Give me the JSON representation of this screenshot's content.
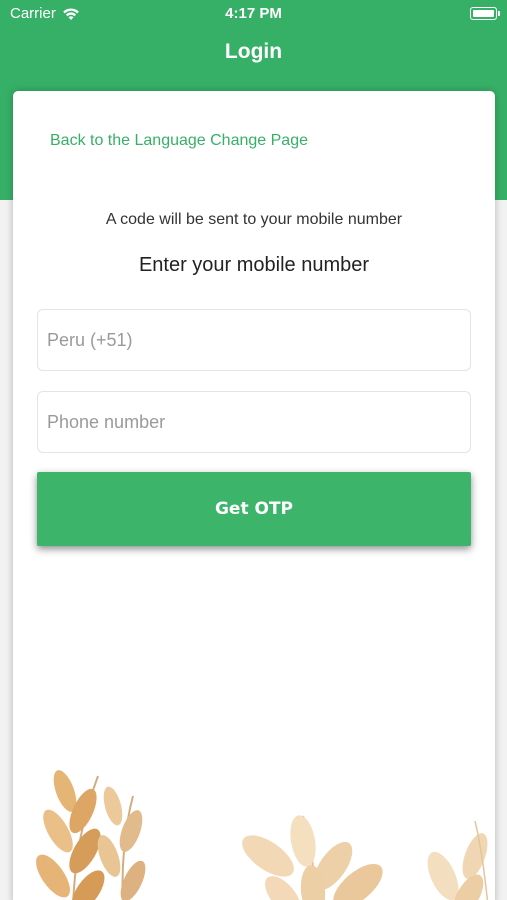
{
  "status_bar": {
    "carrier": "Carrier",
    "time": "4:17 PM"
  },
  "nav": {
    "title": "Login"
  },
  "card": {
    "back_link": "Back to the Language Change Page",
    "info_text": "A code will be sent to your mobile number",
    "heading": "Enter your mobile number",
    "country_field": "Peru (+51)",
    "phone_placeholder": "Phone number",
    "otp_button": "Get OTP"
  },
  "colors": {
    "brand_green": "#37b067",
    "button_green": "#3cb46a"
  }
}
